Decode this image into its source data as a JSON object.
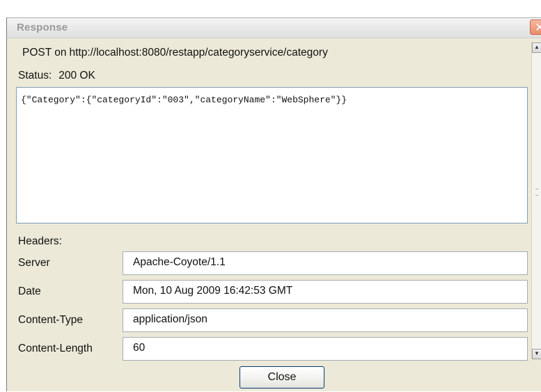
{
  "window": {
    "title": "Response",
    "close_glyph": "✕"
  },
  "request": {
    "method_prefix": "POST on",
    "url": "http://localhost:8080/restapp/categoryservice/category"
  },
  "status": {
    "label": "Status:",
    "value": "200 OK"
  },
  "response_body": "{\"Category\":{\"categoryId\":\"003\",\"categoryName\":\"WebSphere\"}}",
  "headers": {
    "label": "Headers:",
    "rows": [
      {
        "name": "Server",
        "value": "Apache-Coyote/1.1"
      },
      {
        "name": "Date",
        "value": "Mon, 10 Aug 2009 16:42:53 GMT"
      },
      {
        "name": "Content-Type",
        "value": "application/json"
      },
      {
        "name": "Content-Length",
        "value": "60"
      }
    ]
  },
  "scrollbar": {
    "up_glyph": "▲",
    "down_glyph": "▼"
  },
  "buttons": {
    "close_label": "Close"
  }
}
